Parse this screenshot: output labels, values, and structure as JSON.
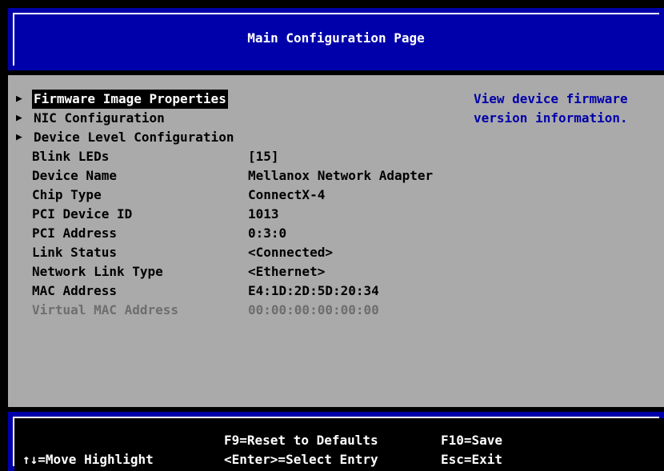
{
  "colors": {
    "screen_bg": "#000000",
    "title_bg": "#0000aa",
    "panel_bg": "#aaaaaa",
    "text": "#000000",
    "help_text": "#0000aa",
    "highlight_bg": "#000000",
    "highlight_text": "#ffffff",
    "disabled_text": "#6e6e6e"
  },
  "header": {
    "title": "Main Configuration Page"
  },
  "menu": {
    "nav_items": [
      {
        "label": "Firmware Image Properties",
        "icon": "triangle-right-icon",
        "selected": true
      },
      {
        "label": "NIC Configuration",
        "icon": "triangle-right-icon",
        "selected": false
      },
      {
        "label": "Device Level Configuration",
        "icon": "triangle-right-icon",
        "selected": false
      }
    ],
    "fields": [
      {
        "label": "Blink LEDs",
        "value": "[15]"
      },
      {
        "label": "Device Name",
        "value": "Mellanox Network Adapter"
      },
      {
        "label": "Chip Type",
        "value": "ConnectX-4"
      },
      {
        "label": "PCI Device ID",
        "value": "1013"
      },
      {
        "label": "PCI Address",
        "value": "0:3:0"
      },
      {
        "label": "Link Status",
        "value": "<Connected>"
      },
      {
        "label": "Network Link Type",
        "value": "<Ethernet>"
      },
      {
        "label": "MAC Address",
        "value": "E4:1D:2D:5D:20:34"
      },
      {
        "label": "Virtual MAC Address",
        "value": "00:00:00:00:00:00",
        "disabled": true
      }
    ]
  },
  "help": {
    "text": "View device firmware\nversion information."
  },
  "footer": {
    "move_highlight": "↑↓=Move Highlight",
    "reset_defaults": "F9=Reset to Defaults",
    "select_entry": "<Enter>=Select Entry",
    "save": "F10=Save",
    "exit": "Esc=Exit"
  }
}
